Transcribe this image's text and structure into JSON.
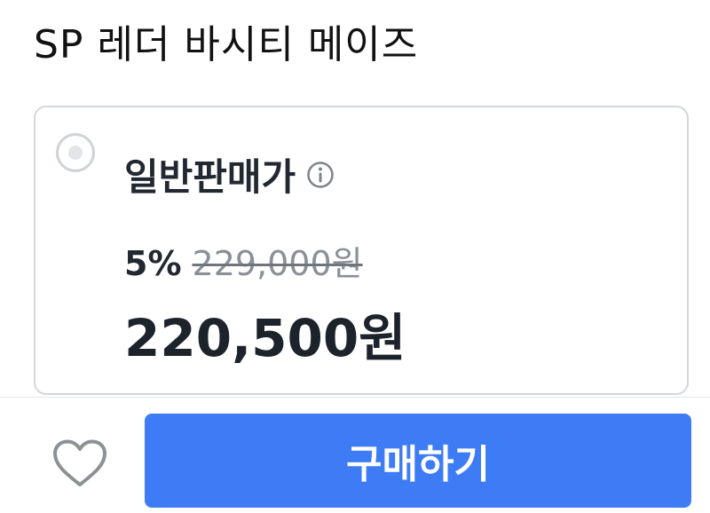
{
  "product": {
    "title": "SP 레더 바시티 메이즈"
  },
  "option": {
    "label": "일반판매가",
    "selected": false,
    "discount_rate": "5%",
    "original_price": "229,000원",
    "sale_price": "220,500원",
    "info_icon": "info-circle-icon"
  },
  "actions": {
    "like_icon": "heart-icon",
    "buy_label": "구매하기"
  },
  "colors": {
    "accent": "#3d7cf4",
    "text_primary": "#1f2329",
    "text_muted": "#8a9098",
    "border": "#d4d7db"
  }
}
